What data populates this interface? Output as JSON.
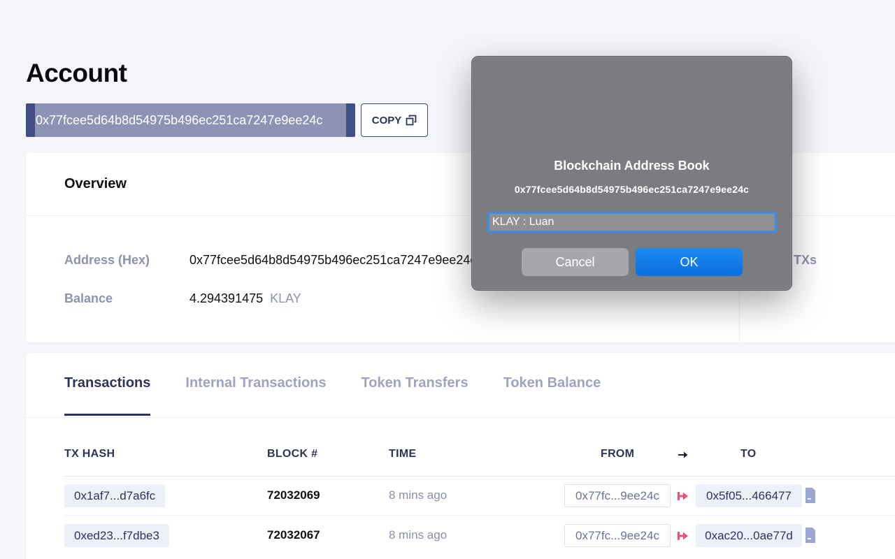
{
  "page": {
    "title": "Account"
  },
  "address_bar": {
    "address": "0x77fcee5d64b8d54975b496ec251ca7247e9ee24c",
    "copy_label": "COPY"
  },
  "overview": {
    "title": "Overview",
    "address_label": "Address (Hex)",
    "address_value": "0x77fcee5d64b8d54975b496ec251ca7247e9ee24c",
    "balance_label": "Balance",
    "balance_value": "4.294391475",
    "balance_unit": "KLAY",
    "side_label": "al TXs"
  },
  "tabs": [
    {
      "label": "Transactions",
      "active": true
    },
    {
      "label": "Internal Transactions",
      "active": false
    },
    {
      "label": "Token Transfers",
      "active": false
    },
    {
      "label": "Token Balance",
      "active": false
    }
  ],
  "table": {
    "headers": {
      "tx_hash": "TX HASH",
      "block": "BLOCK #",
      "time": "TIME",
      "from": "FROM",
      "to": "TO"
    },
    "rows": [
      {
        "tx_hash": "0x1af7...d7a6fc",
        "block": "72032069",
        "time": "8 mins ago",
        "from": "0x77fc...9ee24c",
        "to": "0x5f05...466477"
      },
      {
        "tx_hash": "0xed23...f7dbe3",
        "block": "72032067",
        "time": "8 mins ago",
        "from": "0x77fc...9ee24c",
        "to": "0xac20...0ae77d"
      }
    ]
  },
  "modal": {
    "title": "Blockchain Address Book",
    "address": "0x77fcee5d64b8d54975b496ec251ca7247e9ee24c",
    "input_value": "KLAY : Luan",
    "cancel_label": "Cancel",
    "ok_label": "OK"
  },
  "colors": {
    "primary": "#2d3457",
    "address_highlight": "#8d93b5",
    "ok_blue": "#0a6fe0",
    "arrow_red": "#f0506e"
  },
  "icons": {
    "copy": "copy-icon",
    "direction": "arrow-right-icon",
    "transfer": "red-arrow-icon",
    "contract": "document-icon"
  }
}
